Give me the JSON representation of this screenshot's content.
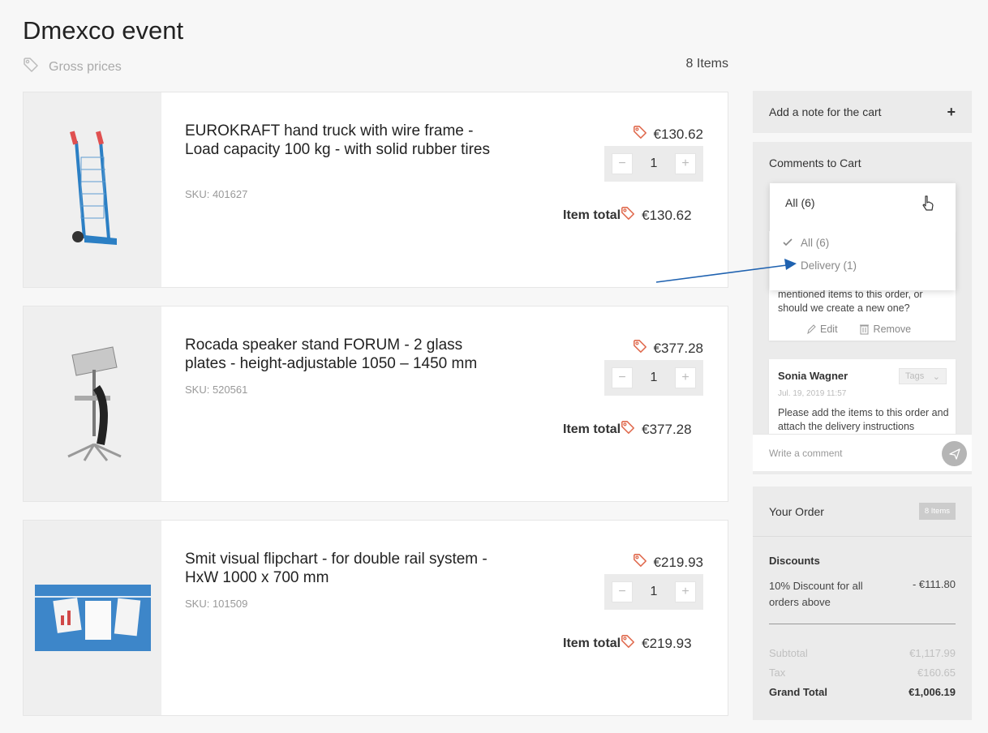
{
  "page": {
    "title": "Dmexco event",
    "price_mode": "Gross prices",
    "item_count": "8 Items"
  },
  "products": [
    {
      "name": "EUROKRAFT hand truck with wire frame - Load capacity 100 kg - with solid rubber tires",
      "sku": "SKU: 401627",
      "unit_price": "€130.62",
      "qty": "1",
      "total_label": "Item total",
      "total": "€130.62"
    },
    {
      "name": "Rocada speaker stand FORUM - 2 glass plates - height-adjustable 1050 – 1450 mm",
      "sku": "SKU: 520561",
      "unit_price": "€377.28",
      "qty": "1",
      "total_label": "Item total",
      "total": "€377.28"
    },
    {
      "name": "Smit visual flipchart - for double rail system - HxW 1000 x 700 mm",
      "sku": "SKU: 101509",
      "unit_price": "€219.93",
      "qty": "1",
      "total_label": "Item total",
      "total": "€219.93"
    }
  ],
  "stepper": {
    "minus": "−",
    "plus": "+"
  },
  "note": {
    "label": "Add a note for the cart",
    "plus": "+"
  },
  "comments": {
    "title": "Comments to Cart",
    "filter": {
      "selected": "All (6)",
      "options": [
        {
          "label": "All (6)",
          "checked": true
        },
        {
          "label": "Delivery (1)",
          "checked": false
        }
      ]
    },
    "card1": {
      "text": "mentioned items to this order, or should we create a new one?",
      "edit": "Edit",
      "remove": "Remove"
    },
    "card2": {
      "author": "Sonia Wagner",
      "tags": "Tags",
      "date": "Jul. 19, 2019 11:57",
      "text": "Please add the items to this order and attach the delivery instructions"
    },
    "input_placeholder": "Write a comment"
  },
  "order": {
    "title": "Your Order",
    "badge": "8 Items"
  },
  "summary": {
    "discounts_heading": "Discounts",
    "discount_text": "10% Discount for all orders above",
    "discount_value": "- €111.80",
    "subtotal_label": "Subtotal",
    "subtotal": "€1,117.99",
    "tax_label": "Tax",
    "tax": "€160.65",
    "grand_total_label": "Grand Total",
    "grand_total": "€1,006.19"
  },
  "colors": {
    "accent_tag": "#e06a4e",
    "arrow": "#1f62b0"
  }
}
